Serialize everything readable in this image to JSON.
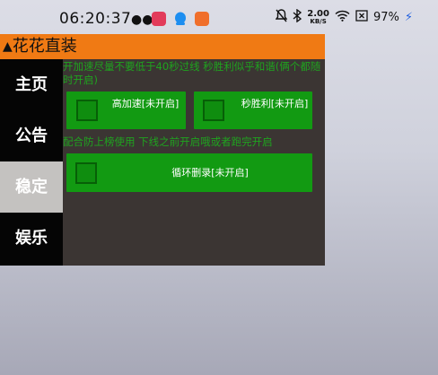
{
  "status_bar": {
    "time": "06:20:37",
    "net_speed_value": "2.00",
    "net_speed_unit": "KB/S",
    "battery": "97%",
    "icons": [
      "wechat-icon",
      "app-red-icon",
      "qq-icon",
      "app-orange-icon",
      "mute-icon",
      "bluetooth-icon",
      "wifi-icon",
      "close-box-icon",
      "charging-icon"
    ]
  },
  "panel": {
    "title": "花花直装",
    "nav": [
      {
        "label": "主页",
        "active": false
      },
      {
        "label": "公告",
        "active": false
      },
      {
        "label": "稳定",
        "active": true
      },
      {
        "label": "娱乐",
        "active": false
      }
    ],
    "note1": "开加速尽量不要低于40秒过线 秒胜利似乎和谐(俩个都随时开启)",
    "note2": "配合防上榜使用 下线之前开启哦或者跑完开启",
    "buttons": {
      "speed_label": "高加速[未开启]",
      "win_label": "秒胜利[未开启]",
      "loop_label": "循环删录[未开启]"
    }
  },
  "colors": {
    "title_bar": "#f07a14",
    "panel_bg": "#3b3533",
    "button_green": "#129a12",
    "note_text": "#1fa31f",
    "sidebar_bg": "#050505",
    "nav_active": "#c4c2c0"
  }
}
